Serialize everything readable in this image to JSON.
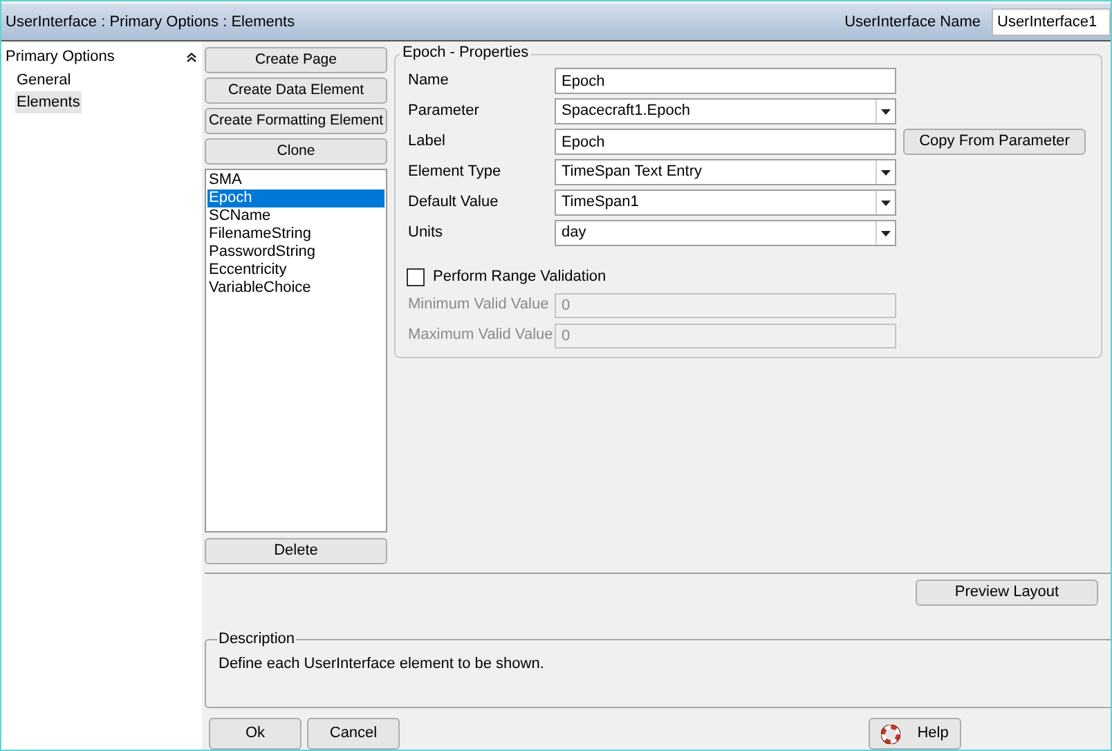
{
  "window": {
    "title": "UserInterface : Primary Options : Elements"
  },
  "ui_name": {
    "label": "UserInterface Name",
    "value": "UserInterface1"
  },
  "sidebar": {
    "title": "Primary Options",
    "items": [
      {
        "label": "General",
        "selected": false
      },
      {
        "label": "Elements",
        "selected": true
      }
    ]
  },
  "actions": [
    "Create Page",
    "Create Data Element",
    "Create Formatting Element",
    "Clone"
  ],
  "elements": [
    {
      "label": "SMA",
      "selected": false
    },
    {
      "label": "Epoch",
      "selected": true
    },
    {
      "label": "SCName",
      "selected": false
    },
    {
      "label": "FilenameString",
      "selected": false
    },
    {
      "label": "PasswordString",
      "selected": false
    },
    {
      "label": "Eccentricity",
      "selected": false
    },
    {
      "label": "VariableChoice",
      "selected": false
    }
  ],
  "delete_button": "Delete",
  "properties": {
    "title": "Epoch - Properties",
    "fields": [
      {
        "label": "Name",
        "value": "Epoch",
        "kind": "text"
      },
      {
        "label": "Parameter",
        "value": "Spacecraft1.Epoch",
        "kind": "dropdown"
      },
      {
        "label": "Label",
        "value": "Epoch",
        "kind": "text",
        "button": "Copy From Parameter"
      },
      {
        "label": "Element Type",
        "value": "TimeSpan Text Entry",
        "kind": "dropdown"
      },
      {
        "label": "Default Value",
        "value": "TimeSpan1",
        "kind": "dropdown"
      },
      {
        "label": "Units",
        "value": "day",
        "kind": "dropdown"
      }
    ],
    "range_validation": {
      "label": "Perform Range Validation",
      "checked": false
    },
    "range_fields": [
      {
        "label": "Minimum Valid Value",
        "value": "0",
        "disabled": true
      },
      {
        "label": "Maximum Valid Value",
        "value": "0",
        "disabled": true
      }
    ]
  },
  "preview_button": "Preview Layout",
  "description": {
    "title": "Description",
    "text": "Define each UserInterface element to be shown."
  },
  "buttons": [
    {
      "label": "Ok",
      "kind": "plain"
    },
    {
      "label": "Cancel",
      "kind": "plain"
    },
    {
      "label": "Help",
      "kind": "help"
    }
  ]
}
